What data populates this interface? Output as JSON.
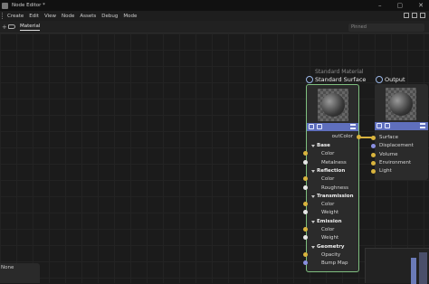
{
  "window": {
    "title": "Node Editor *",
    "controls": [
      "–",
      "▢",
      "✕"
    ]
  },
  "menu": {
    "items": [
      "Create",
      "Edit",
      "View",
      "Node",
      "Assets",
      "Debug",
      "Mode"
    ]
  },
  "tabs": {
    "items": [
      "Material"
    ],
    "pinned_placeholder": "Pinned"
  },
  "nodes": {
    "caption": "Standard Material",
    "standard_surface": {
      "title": "Standard Surface",
      "output_label": "outColor",
      "rows": [
        {
          "kind": "group",
          "label": "Base"
        },
        {
          "kind": "input",
          "label": "Color",
          "port_color": "#d9b43d"
        },
        {
          "kind": "input",
          "label": "Metalness",
          "port_color": "#e6e6e6"
        },
        {
          "kind": "group",
          "label": "Reflection"
        },
        {
          "kind": "input",
          "label": "Color",
          "port_color": "#d9b43d"
        },
        {
          "kind": "input",
          "label": "Roughness",
          "port_color": "#e6e6e6"
        },
        {
          "kind": "group",
          "label": "Transmission"
        },
        {
          "kind": "input",
          "label": "Color",
          "port_color": "#d9b43d"
        },
        {
          "kind": "input",
          "label": "Weight",
          "port_color": "#e6e6e6"
        },
        {
          "kind": "group",
          "label": "Emission"
        },
        {
          "kind": "input",
          "label": "Color",
          "port_color": "#d9b43d"
        },
        {
          "kind": "input",
          "label": "Weight",
          "port_color": "#e6e6e6"
        },
        {
          "kind": "group",
          "label": "Geometry"
        },
        {
          "kind": "input",
          "label": "Opacity",
          "port_color": "#d9b43d"
        },
        {
          "kind": "input",
          "label": "Bump Map",
          "port_color": "#8a8fe0"
        }
      ]
    },
    "output": {
      "title": "Output",
      "rows": [
        {
          "label": "Surface",
          "port_color": "#d9b43d"
        },
        {
          "label": "Displacement",
          "port_color": "#8a8fe0"
        },
        {
          "label": "Volume",
          "port_color": "#d9b43d"
        },
        {
          "label": "Environment",
          "port_color": "#d9b43d"
        },
        {
          "label": "Light",
          "port_color": "#d9b43d"
        }
      ]
    }
  },
  "bottom_panel": {
    "label": "None"
  },
  "colors": {
    "accent": "#5f6fbd",
    "wire": "#d8b23f",
    "selection": "#7fbf7f",
    "background": "#1b1b1b"
  }
}
